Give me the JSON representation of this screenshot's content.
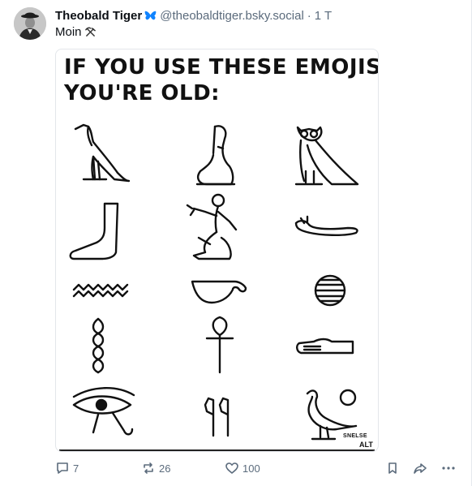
{
  "post": {
    "author": {
      "display_name": "Theobald Tiger",
      "handle": "@theobaldtiger.bsky.social",
      "separator": "·",
      "time": "1 T"
    },
    "text": "Moin",
    "text_emoji_icon": "hammer-and-pick-icon",
    "image": {
      "title_line1": "IF YOU USE THESE EMOJIS",
      "title_line2": "YOU'RE OLD:",
      "signature": "SNELSE",
      "alt_badge": "ALT",
      "glyph_icons": [
        "vulture-hieroglyph-icon",
        "seated-woman-hieroglyph-icon",
        "owl-hieroglyph-icon",
        "foot-hieroglyph-icon",
        "seated-man-hieroglyph-icon",
        "horned-viper-hieroglyph-icon",
        "water-hieroglyph-icon",
        "basket-hieroglyph-icon",
        "placenta-hieroglyph-icon",
        "twisted-flax-hieroglyph-icon",
        "ankh-hieroglyph-icon",
        "hand-hieroglyph-icon",
        "eye-of-horus-hieroglyph-icon",
        "double-reed-hieroglyph-icon",
        "goose-and-sun-hieroglyph-icon"
      ]
    },
    "actions": {
      "reply_count": "7",
      "repost_count": "26",
      "like_count": "100"
    }
  },
  "colors": {
    "muted": "#5b6b7c",
    "text": "#0b0f14",
    "verified_butterfly": "#1083fe"
  }
}
